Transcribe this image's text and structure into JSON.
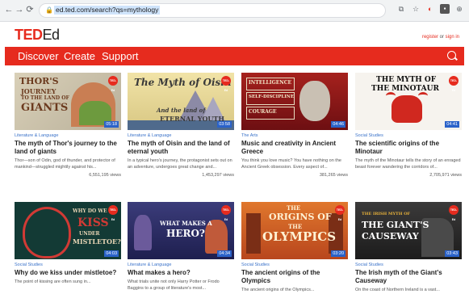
{
  "browser": {
    "url": "ed.ted.com/search?qs=mythology"
  },
  "header": {
    "logo_ted": "TED",
    "logo_ed": "Ed",
    "register": "register",
    "or": "or",
    "signin": "sign in"
  },
  "nav": {
    "items": [
      "Discover",
      "Create",
      "Support"
    ]
  },
  "cards": [
    {
      "category": "Literature & Language",
      "title": "The myth of Thor's journey to the land of giants",
      "desc": "Thor—son of Odin, god of thunder, and protector of mankind—struggled mightily against his...",
      "views": "6,551,195 views",
      "duration": "05:18",
      "thumb_lines": [
        "THOR'S",
        "JOURNEY",
        "TO THE LAND OF",
        "GIANTS"
      ]
    },
    {
      "category": "Literature & Language",
      "title": "The myth of Oisin and the land of eternal youth",
      "desc": "In a typical hero's journey, the protagonist sets out on an adventure, undergoes great change and...",
      "views": "1,453,297 views",
      "duration": "03:58",
      "thumb_lines": [
        "The Myth of Oisin",
        "And the land of",
        "ETERNAL YOUTH"
      ]
    },
    {
      "category": "The Arts",
      "title": "Music and creativity in Ancient Greece",
      "desc": "You think you love music? You have nothing on the Ancient Greek obsession. Every aspect of...",
      "views": "381,265 views",
      "duration": "04:46",
      "thumb_lines": [
        "INTELLIGENCE",
        "SELF-DISCIPLINE",
        "COURAGE"
      ]
    },
    {
      "category": "Social Studies",
      "title": "The scientific origins of the Minotaur",
      "desc": "The myth of the Minotaur tells the story of an enraged beast forever wandering the corridors of...",
      "views": "2,705,971 views",
      "duration": "04:41",
      "thumb_lines": [
        "THE MYTH OF",
        "THE MINOTAUR"
      ]
    },
    {
      "category": "Social Studies",
      "title": "Why do we kiss under mistletoe?",
      "desc": "The point of kissing are often sung in...",
      "views": "",
      "duration": "04:03",
      "thumb_lines": [
        "WHY DO WE",
        "KISS",
        "UNDER",
        "MISTLETOE?"
      ]
    },
    {
      "category": "Literature & Language",
      "title": "What makes a hero?",
      "desc": "What trials unite not only Harry Potter or Frodo Baggins to a group of literature's most...",
      "views": "",
      "duration": "04:34",
      "thumb_lines": [
        "WHAT MAKES A",
        "HERO?"
      ]
    },
    {
      "category": "Social Studies",
      "title": "The ancient origins of the Olympics",
      "desc": "The ancient origins of the Olympics...",
      "views": "",
      "duration": "03:20",
      "thumb_lines": [
        "THE",
        "ORIGINS OF",
        "THE",
        "OLYMPICS"
      ]
    },
    {
      "category": "Social Studies",
      "title": "The Irish myth of the Giant's Causeway",
      "desc": "On the coast of Northern Ireland is a vast...",
      "views": "",
      "duration": "03:43",
      "thumb_lines": [
        "THE IRISH MYTH OF",
        "THE GIANT'S",
        "CAUSEWAY"
      ]
    }
  ],
  "badge_text": "TED-Ed",
  "colors": {
    "ted_red": "#e62b1e",
    "category_blue": "#3a72c9"
  }
}
